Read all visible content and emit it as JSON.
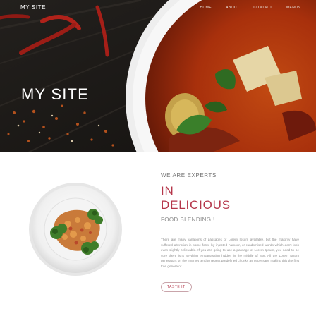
{
  "brand": "MY SITE",
  "nav": [
    "HOME",
    "ABOUT",
    "CONTACT",
    "MENUS"
  ],
  "hero": {
    "title": "MY SITE"
  },
  "about": {
    "kicker": "WE ARE EXPERTS",
    "headline_line1": "IN",
    "headline_line2": "DELICIOUS",
    "subline": "FOOD BLENDING !",
    "body": "There are many variations of passages of Lorem Ipsum available, but the majority have suffered alteration in some form, by injected humour, or randomised words which don't look even slightly believable. If you are going to use a passage of Lorem Ipsum, you need to be sure there isn't anything embarrassing hidden in the middle of text. All the Lorem Ipsum generators on the Internet tend to repeat predefined chunks as necessary, making this the first true generator",
    "cta": "TASTE IT"
  },
  "colors": {
    "accent": "#b5364a",
    "hero_bg": "#1c1a18",
    "text_muted": "#8f8f8f"
  }
}
